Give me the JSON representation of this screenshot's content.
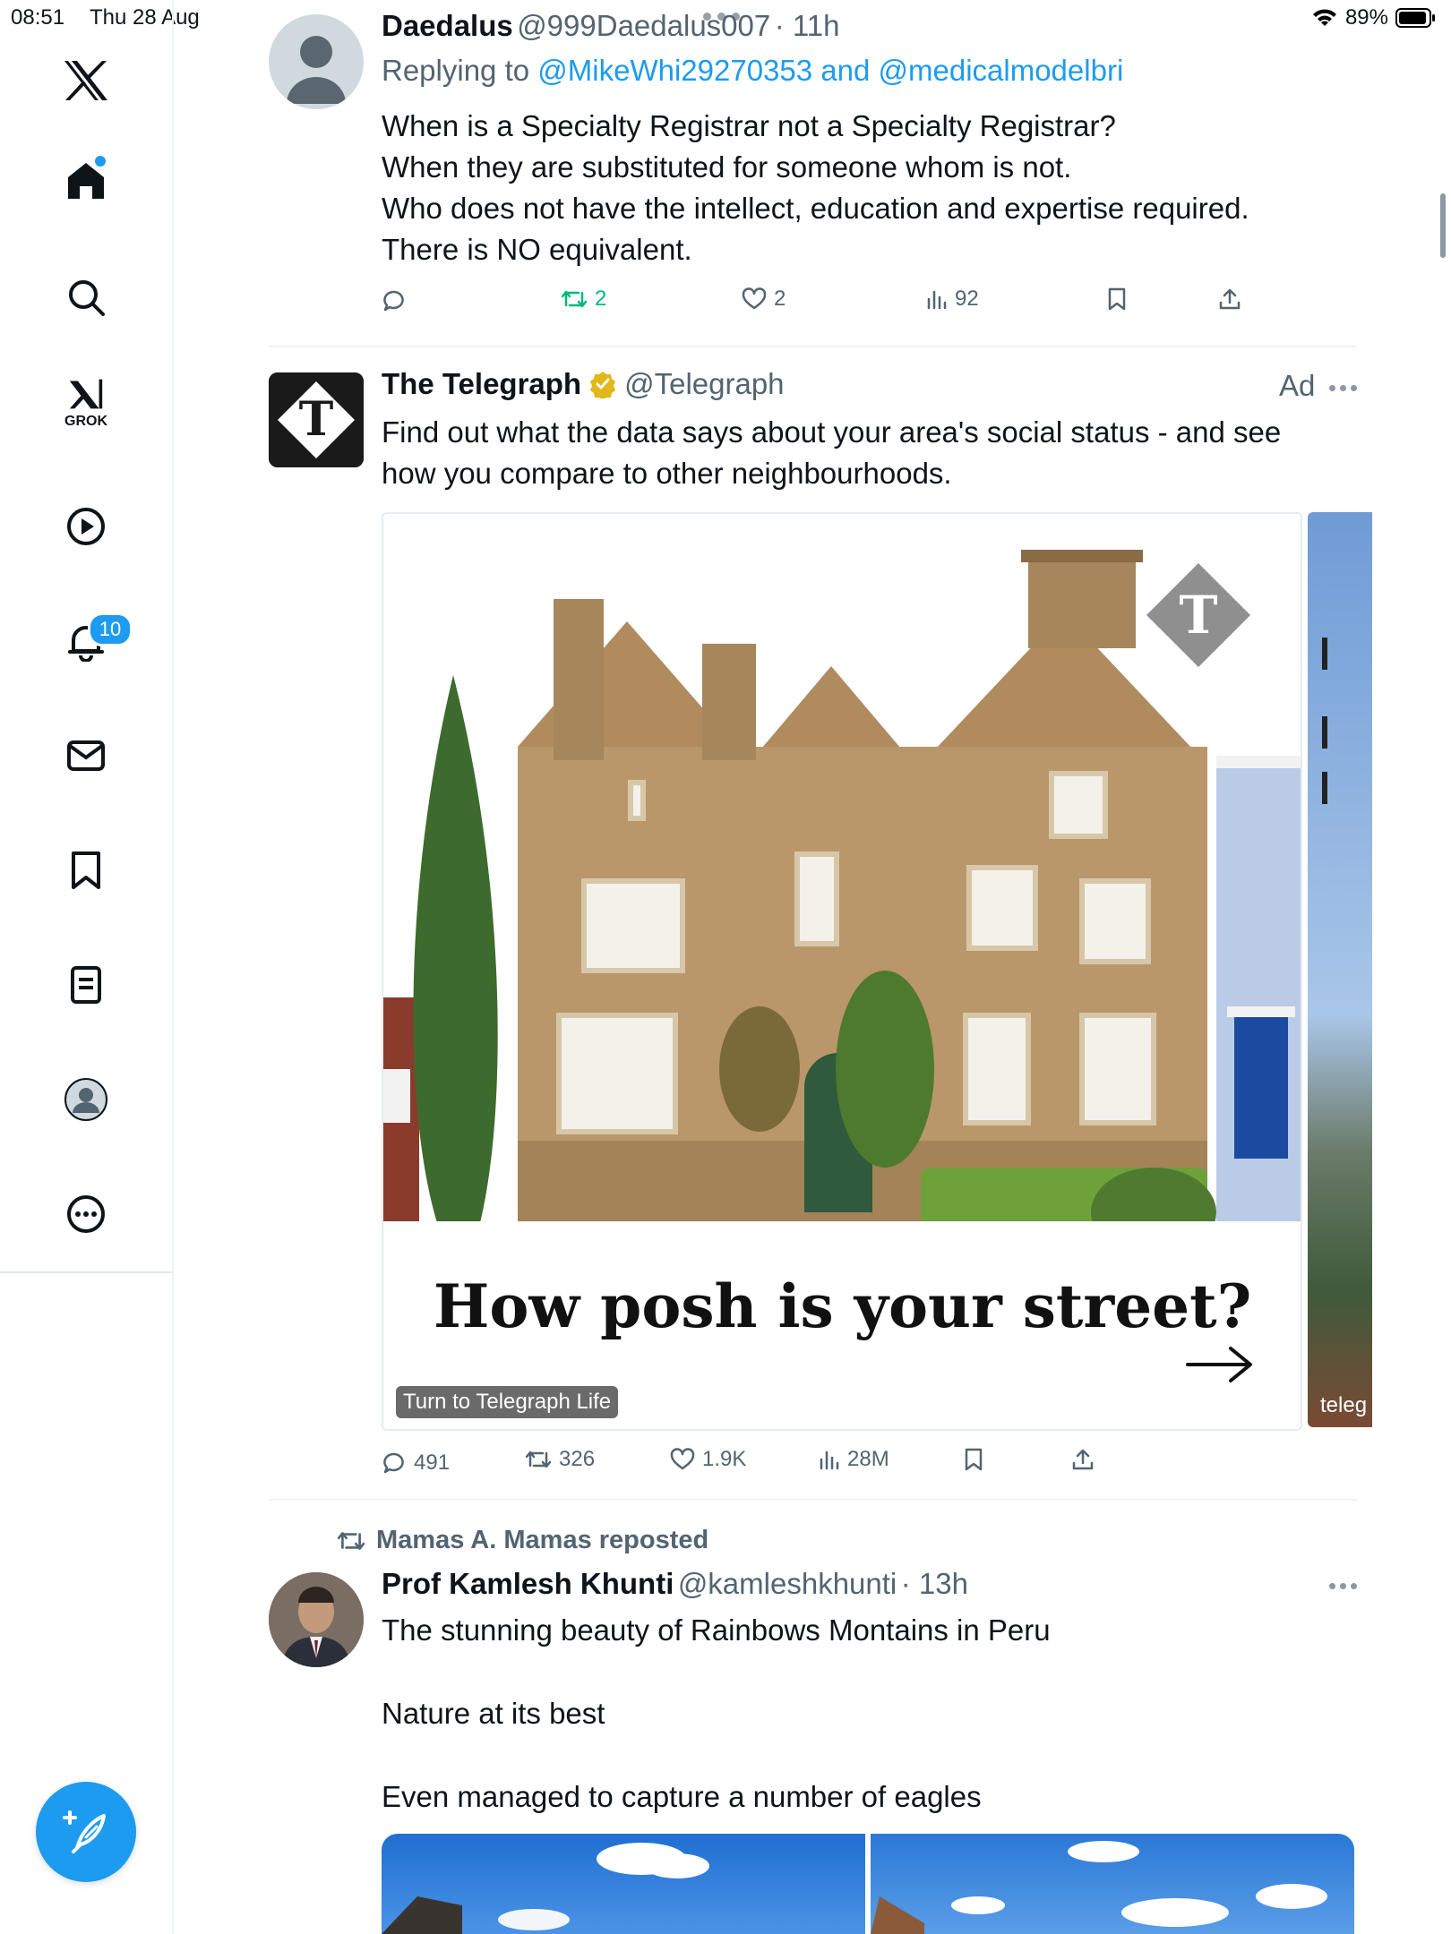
{
  "status_bar": {
    "time": "08:51",
    "date": "Thu 28 Aug",
    "battery": "89%"
  },
  "sidebar": {
    "notifications_count": "10",
    "grok_label": "GROK",
    "items": [
      "x-logo",
      "home",
      "search",
      "grok",
      "video",
      "notifications",
      "messages",
      "bookmarks",
      "lists",
      "profile",
      "more"
    ]
  },
  "tweet1": {
    "name": "Daedalus",
    "handle": "@999Daedalus007",
    "time": "· 11h",
    "replying_prefix": "Replying to",
    "replying_to": "@MikeWhi29270353 and @medicalmodelbri",
    "lines": [
      "When is a Specialty Registrar not a Specialty Registrar?",
      "When they are substituted for someone whom is not.",
      "Who does not have the intellect, education and expertise required.",
      "There is NO equivalent."
    ],
    "retweets": "2",
    "likes": "2",
    "views": "92"
  },
  "ad": {
    "name": "The Telegraph",
    "handle": "@Telegraph",
    "ad_label": "Ad",
    "text_lines": [
      "Find out what the data says about your area's social status - and see",
      "how you compare to other neighbourhoods."
    ],
    "card_headline": "How posh is your street?",
    "card_cta": "Turn to Telegraph Life",
    "card2_caption": "teleg",
    "replies": "491",
    "retweets": "326",
    "likes": "1.9K",
    "views": "28M"
  },
  "tweet3": {
    "reposted_by": "Mamas A. Mamas reposted",
    "name": "Prof Kamlesh Khunti",
    "handle": "@kamleshkhunti",
    "time": "· 13h",
    "lines": [
      "The stunning beauty of Rainbows Montains  in Peru",
      "",
      "Nature at its best",
      "",
      "Even managed to capture a number of eagles"
    ]
  },
  "colors": {
    "accent": "#1d9bf0",
    "retweet_green": "#00ba7c",
    "muted": "#536471"
  }
}
